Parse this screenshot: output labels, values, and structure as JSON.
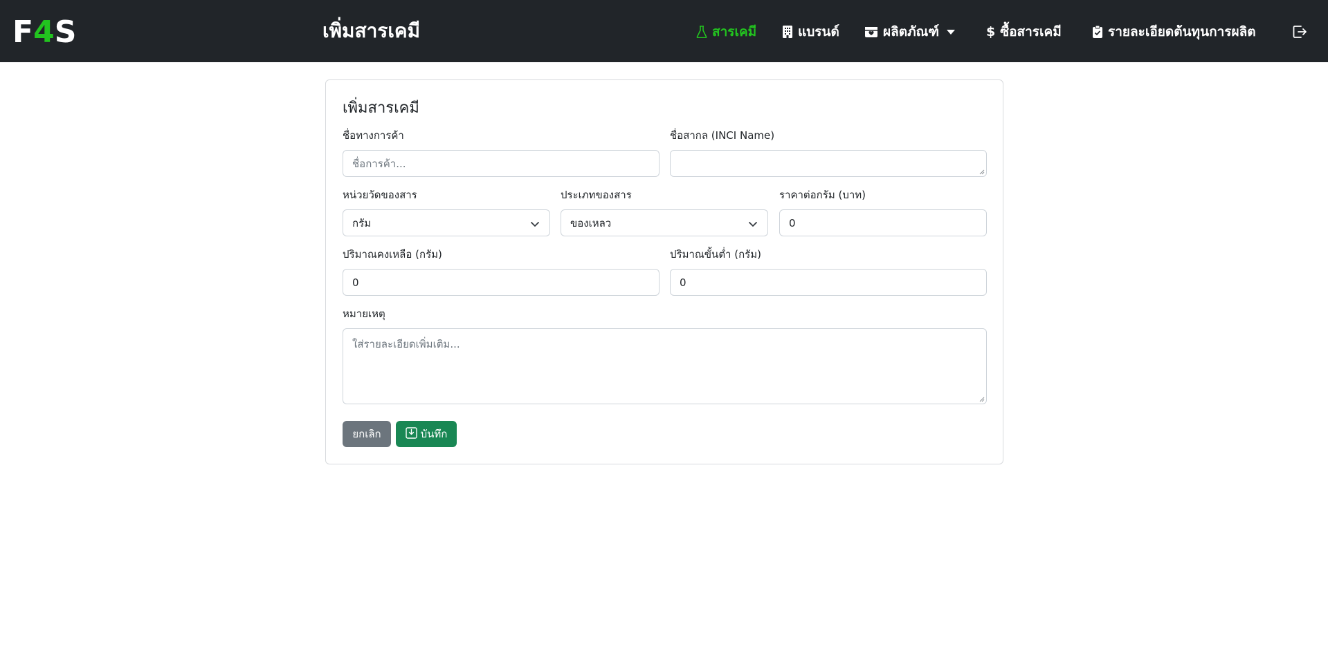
{
  "app": {
    "logo_left": "F",
    "logo_accent": "4",
    "logo_right": "S",
    "page_title": "เพิ่มสารเคมี"
  },
  "nav": {
    "items": [
      {
        "label": "สารเคมี",
        "icon": "flask-icon",
        "active": true
      },
      {
        "label": "แบรนด์",
        "icon": "building-icon",
        "active": false
      },
      {
        "label": "ผลิตภัณฑ์",
        "icon": "box-seam-icon",
        "active": false,
        "dropdown": true
      },
      {
        "label": "ซื้อสารเคมี",
        "icon": "dollar-icon",
        "active": false
      },
      {
        "label": "รายละเอียดต้นทุนการผลิต",
        "icon": "clipboard-check-icon",
        "active": false
      }
    ],
    "logout_icon": "box-arrow-right-icon"
  },
  "form": {
    "title": "เพิ่มสารเคมี",
    "trade_name": {
      "label": "ชื่อทางการค้า",
      "placeholder": "ชื่อการค้า...",
      "value": ""
    },
    "inci_name": {
      "label": "ชื่อสากล (INCI Name)",
      "value": ""
    },
    "unit": {
      "label": "หน่วยวัดของสาร",
      "selected": "กรัม"
    },
    "type": {
      "label": "ประเภทของสาร",
      "selected": "ของเหลว"
    },
    "price": {
      "label": "ราคาต่อกรัม (บาท)",
      "value": "0"
    },
    "stock": {
      "label": "ปริมาณคงเหลือ (กรัม)",
      "value": "0"
    },
    "minimum": {
      "label": "ปริมาณขั้นต่ำ (กรัม)",
      "value": "0"
    },
    "note": {
      "label": "หมายเหตุ",
      "placeholder": "ใส่รายละเอียดเพิ่มเติม..."
    },
    "cancel_label": "ยกเลิก",
    "save_label": "บันทึก"
  },
  "colors": {
    "navbar_bg": "#212529",
    "accent_green": "#22c41f",
    "cancel_bg": "#6c757d",
    "save_bg": "#198754"
  }
}
